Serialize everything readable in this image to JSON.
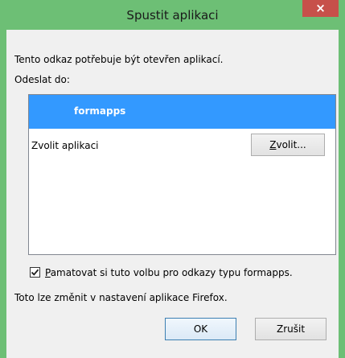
{
  "window": {
    "title": "Spustit aplikaci",
    "close_glyph": "×"
  },
  "message": "Tento odkaz potřebuje být otevřen aplikací.",
  "send_to_label": "Odeslat do:",
  "app_list": {
    "selected_item": "formapps",
    "choose_row_label": "Zvolit aplikaci",
    "choose_button": {
      "accel": "Z",
      "rest": "volit..."
    }
  },
  "remember": {
    "checked": true,
    "accel": "P",
    "rest": "amatovat si tuto volbu pro odkazy typu formapps."
  },
  "note": "Toto lze změnit v nastavení aplikace Firefox.",
  "buttons": {
    "ok": "OK",
    "cancel": "Zrušit"
  },
  "colors": {
    "frame": "#6dbf75",
    "close": "#c7504a",
    "selection": "#3399ff"
  },
  "icons": {
    "close": "close-icon",
    "check": "checkmark-icon"
  }
}
